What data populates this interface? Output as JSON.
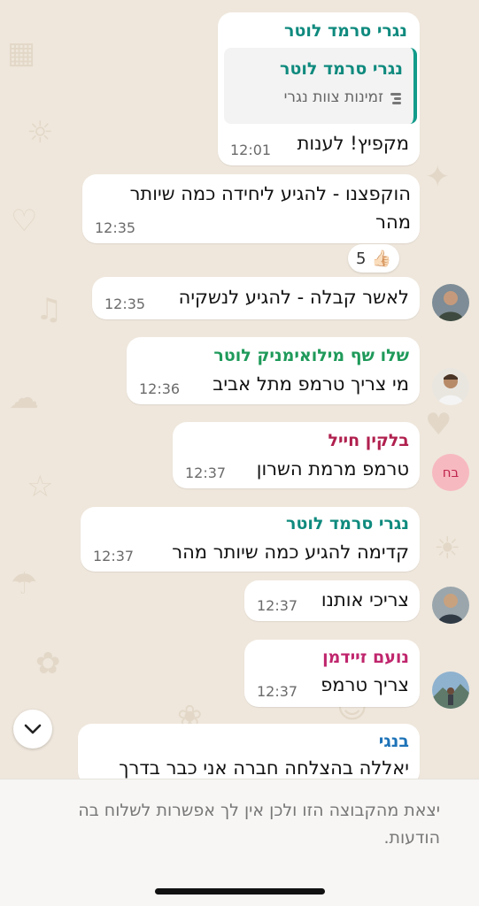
{
  "colors": {
    "chat_background": "#efe7dc",
    "bubble": "#ffffff",
    "sender_teal": "#0f8a7e",
    "sender_green": "#1f9a5a",
    "sender_crimson": "#b0204f",
    "sender_magenta": "#c0266d",
    "sender_blue": "#1e73b8",
    "quote_bar": "#129b8a",
    "avatar_initials_bg": "#f7b9c0",
    "avatar_initials_text": "#c0264f"
  },
  "messages": [
    {
      "sender": "נגרי סרמד לוטר",
      "quote": {
        "sender": "נגרי סרמד לוטר",
        "text": "זמינות צוות נגרי",
        "icon": "poll-icon"
      },
      "text": "מקפיץ! לענות",
      "time": "12:01"
    },
    {
      "text_line1": "הוקפצנו - להגיע ליחידה כמה שיותר",
      "text_line2": "מהר",
      "time": "12:35",
      "reaction": {
        "emoji": "👍🏻",
        "count": "5"
      }
    },
    {
      "text": "לאשר קבלה - להגיע לנשקיה",
      "time": "12:35",
      "avatar": "user-photo-avatar"
    },
    {
      "sender": "שלו שף מילואימניק לוטר",
      "text": "מי צריך טרמפ מתל אביב",
      "time": "12:36",
      "avatar": "user-photo-avatar"
    },
    {
      "sender": "בלקין חייל",
      "text": "טרמפ מרמת השרון",
      "time": "12:37",
      "avatar_initials": "בח"
    },
    {
      "sender": "נגרי סרמד לוטר",
      "text": "קדימה להגיע כמה שיותר מהר",
      "time": "12:37"
    },
    {
      "text": "צריכי אותנו",
      "time": "12:37",
      "avatar": "user-photo-avatar"
    },
    {
      "sender": "נועם זיידמן",
      "text": "צריך טרמפ",
      "time": "12:37",
      "avatar": "user-photo-avatar"
    },
    {
      "sender": "בנגי",
      "text": "יאללה בהצלחה חברה אני כבר בדרך"
    }
  ],
  "scroll_button": {
    "icon": "chevron-down-icon"
  },
  "footer": {
    "notice": "יצאת מהקבוצה הזו ולכן אין לך אפשרות לשלוח בה הודעות."
  }
}
